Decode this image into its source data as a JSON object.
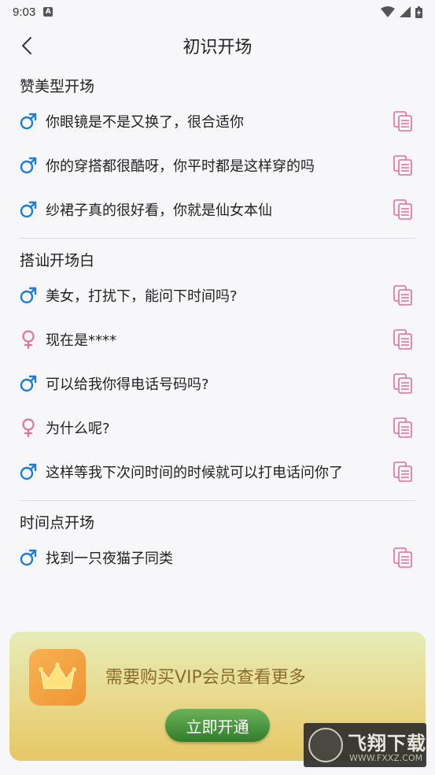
{
  "status_bar": {
    "time": "9:03",
    "a_badge": "A"
  },
  "header": {
    "title": "初识开场"
  },
  "sections": [
    {
      "title": "赞美型开场",
      "lines": [
        {
          "gender": "male",
          "text": "你眼镜是不是又换了，很合适你"
        },
        {
          "gender": "male",
          "text": "你的穿搭都很酷呀，你平时都是这样穿的吗"
        },
        {
          "gender": "male",
          "text": "纱裙子真的很好看，你就是仙女本仙"
        }
      ]
    },
    {
      "title": "搭讪开场白",
      "lines": [
        {
          "gender": "male",
          "text": "美女，打扰下，能问下时间吗?"
        },
        {
          "gender": "female",
          "text": "现在是****"
        },
        {
          "gender": "male",
          "text": "可以给我你得电话号码吗?"
        },
        {
          "gender": "female",
          "text": "为什么呢?"
        },
        {
          "gender": "male",
          "text": "这样等我下次问时间的时候就可以打电话问你了"
        }
      ]
    },
    {
      "title": "时间点开场",
      "lines": [
        {
          "gender": "male",
          "text": "找到一只夜猫子同类"
        }
      ]
    }
  ],
  "vip": {
    "message": "需要购买VIP会员查看更多",
    "button_label": "立即开通"
  },
  "watermark": {
    "big": "飞翔下载",
    "small": "WWW.FXXZ.COM"
  },
  "colors": {
    "male": "#1a7fd4",
    "female": "#e2729a",
    "copy": "#e56aa0"
  }
}
